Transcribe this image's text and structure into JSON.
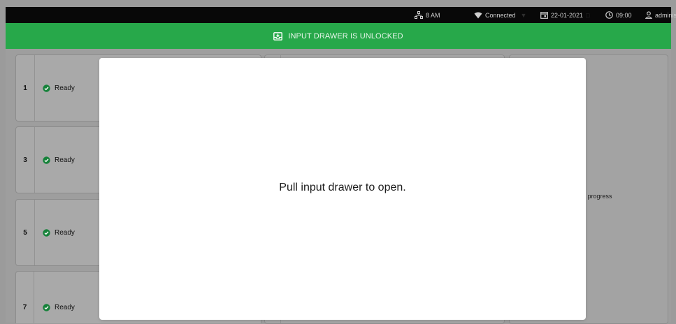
{
  "status_bar": {
    "time_badge": "8 AM",
    "connection": "Connected",
    "date": "22-01-2021",
    "time": "09:00",
    "user": "administrator"
  },
  "banner": {
    "text": "INPUT DRAWER IS UNLOCKED",
    "icon": "drawer-icon",
    "color": "#27a84a"
  },
  "slots": [
    {
      "number": "1",
      "status": "Ready"
    },
    {
      "number": "3",
      "status": "Ready"
    },
    {
      "number": "5",
      "status": "Ready"
    },
    {
      "number": "7",
      "status": "Ready"
    }
  ],
  "right_panel": {
    "partial_text": "n progress"
  },
  "modal": {
    "message": "Pull input drawer to open."
  }
}
